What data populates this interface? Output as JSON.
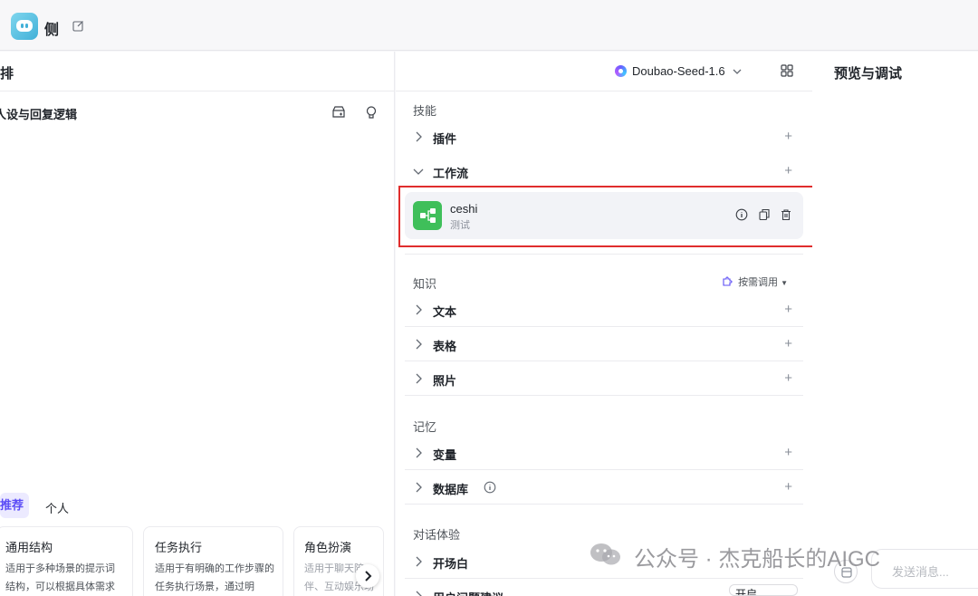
{
  "header": {
    "app_title": "侧"
  },
  "left": {
    "title": "编排",
    "section_title": "人设与回复逻辑",
    "tabs": [
      {
        "label": "推荐"
      },
      {
        "label": "个人"
      }
    ],
    "templates": [
      {
        "title": "通用结构",
        "desc": "适用于多种场景的提示词结构，可以根据具体需求"
      },
      {
        "title": "任务执行",
        "desc": "适用于有明确的工作步骤的任务执行场景，通过明"
      },
      {
        "title": "角色扮演",
        "desc": "适用于聊天陪伴、互动娱乐场景，可帮"
      }
    ]
  },
  "middle": {
    "model": "Doubao-Seed-1.6",
    "groups": {
      "skills": "技能",
      "knowledge": "知识",
      "memory": "记忆",
      "dialog": "对话体验"
    },
    "rows": {
      "plugin": "插件",
      "workflow": "工作流",
      "text": "文本",
      "table": "表格",
      "photo": "照片",
      "variable": "变量",
      "database": "数据库",
      "opening": "开场白",
      "suggestion": "用户问题建议"
    },
    "workflow_item": {
      "name": "ceshi",
      "desc": "测试"
    },
    "on_demand": "按需调用",
    "toggle_value": "开启"
  },
  "right": {
    "title": "预览与调试",
    "send_placeholder": "发送消息..."
  },
  "watermark": "公众号 · 杰克船长的AIGC",
  "colors": {
    "accent": "#5b4cf6",
    "workflow_icon": "#3fbf5a",
    "highlight": "#e02d2d"
  }
}
